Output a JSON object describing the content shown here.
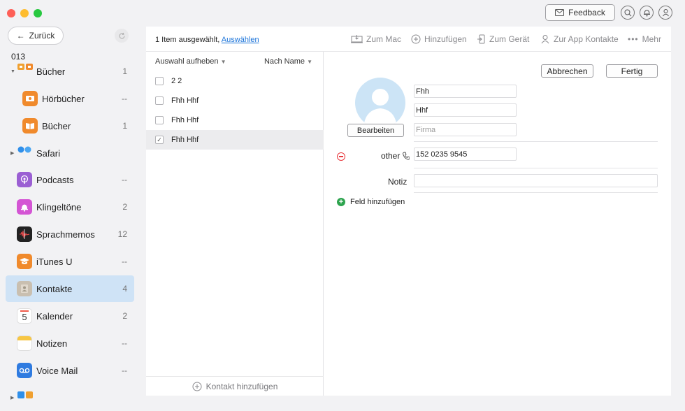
{
  "window": {
    "feedback_label": "Feedback"
  },
  "sidebar": {
    "back_label": "Zurück",
    "device_name": "013",
    "items": [
      {
        "label": "Bücher",
        "count": "1",
        "icon": "books-group-icon",
        "color": "#f0a030"
      },
      {
        "label": "Hörbücher",
        "count": "--",
        "icon": "audiobook-icon",
        "color": "#f08a2c"
      },
      {
        "label": "Bücher",
        "count": "1",
        "icon": "book-icon",
        "color": "#f08a2c"
      },
      {
        "label": "Safari",
        "count": "",
        "icon": "safari-icon",
        "color": "#2f8fea"
      },
      {
        "label": "Podcasts",
        "count": "--",
        "icon": "podcast-icon",
        "color": "#9b5fd3"
      },
      {
        "label": "Klingeltöne",
        "count": "2",
        "icon": "bell-icon",
        "color": "#d455d4"
      },
      {
        "label": "Sprachmemos",
        "count": "12",
        "icon": "voice-memo-icon",
        "color": "#222222"
      },
      {
        "label": "iTunes U",
        "count": "--",
        "icon": "graduation-cap-icon",
        "color": "#f08a2c"
      },
      {
        "label": "Kontakte",
        "count": "4",
        "icon": "contacts-icon",
        "color": "#c9bfb0"
      },
      {
        "label": "Kalender",
        "count": "2",
        "icon": "calendar-icon",
        "color": "#ffffff",
        "day": "5"
      },
      {
        "label": "Notizen",
        "count": "--",
        "icon": "notes-icon",
        "color": "#f7c644"
      },
      {
        "label": "Voice Mail",
        "count": "--",
        "icon": "voicemail-icon",
        "color": "#2f7be0"
      }
    ]
  },
  "toolbar": {
    "selection_text": "1 Item ausgewählt,",
    "selection_link": "Auswählen",
    "to_mac": "Zum Mac",
    "add": "Hinzufügen",
    "to_device": "Zum Gerät",
    "to_app_contacts": "Zur App Kontakte",
    "more": "Mehr"
  },
  "list": {
    "deselect_label": "Auswahl aufheben",
    "sort_label": "Nach Name",
    "rows": [
      {
        "name": "2 2",
        "checked": false
      },
      {
        "name": "Fhh Hhf",
        "checked": false
      },
      {
        "name": "Fhh Hhf",
        "checked": false
      },
      {
        "name": "Fhh Hhf",
        "checked": true
      }
    ],
    "add_contact_label": "Kontakt hinzufügen"
  },
  "detail": {
    "cancel_label": "Abbrechen",
    "done_label": "Fertig",
    "edit_label": "Bearbeiten",
    "first_name": "Fhh",
    "last_name": "Hhf",
    "company_placeholder": "Firma",
    "phone_label": "other",
    "phone_value": "152 0235 9545",
    "note_label": "Notiz",
    "note_value": "",
    "add_field_label": "Feld hinzufügen"
  }
}
